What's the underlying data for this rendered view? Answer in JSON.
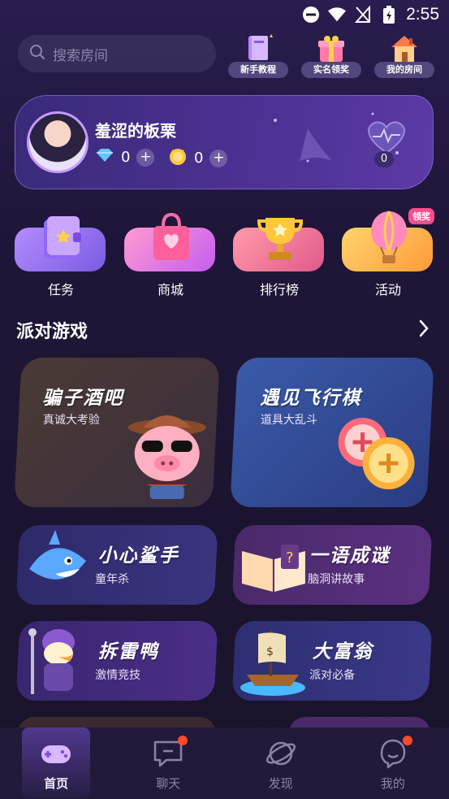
{
  "status_bar": {
    "time": "2:55"
  },
  "header": {
    "search_placeholder": "搜索房间",
    "quick_buttons": [
      {
        "label": "新手教程",
        "icon": "book-icon"
      },
      {
        "label": "实名领奖",
        "icon": "gift-icon"
      },
      {
        "label": "我的房间",
        "icon": "house-icon"
      }
    ]
  },
  "profile": {
    "username": "羞涩的板栗",
    "diamonds": "0",
    "coins": "0",
    "likes": "0"
  },
  "features": [
    {
      "label": "任务",
      "icon": "task-book-icon"
    },
    {
      "label": "商城",
      "icon": "shopping-bag-icon"
    },
    {
      "label": "排行榜",
      "icon": "trophy-icon"
    },
    {
      "label": "活动",
      "icon": "balloon-icon",
      "badge": "领奖"
    }
  ],
  "section": {
    "title": "派对游戏"
  },
  "games": [
    {
      "title": "骗子酒吧",
      "subtitle": "真诚大考验"
    },
    {
      "title": "遇见飞行棋",
      "subtitle": "道具大乱斗"
    },
    {
      "title": "小心鲨手",
      "subtitle": "童年杀"
    },
    {
      "title": "一语成谜",
      "subtitle": "脑洞讲故事"
    },
    {
      "title": "拆雷鸭",
      "subtitle": "激情竞技"
    },
    {
      "title": "大富翁",
      "subtitle": "派对必备"
    }
  ],
  "nav": [
    {
      "label": "首页",
      "active": true
    },
    {
      "label": "聊天",
      "dot": true
    },
    {
      "label": "发现"
    },
    {
      "label": "我的",
      "dot": true
    }
  ],
  "colors": {
    "background": "#1e1638",
    "accent_purple": "#8b5cf6",
    "badge_pink": "#ff4d8d",
    "notify_red": "#ff4a2a"
  }
}
